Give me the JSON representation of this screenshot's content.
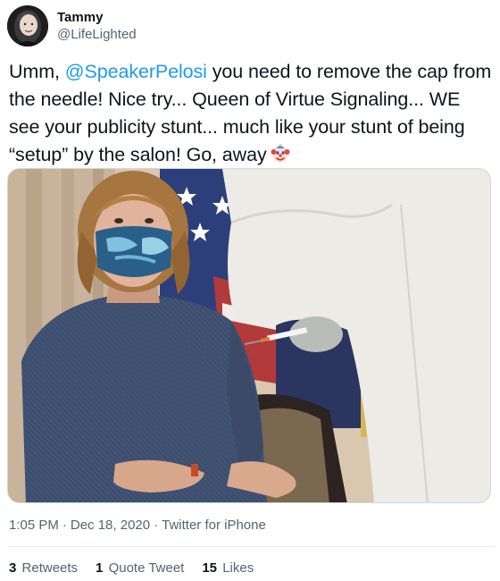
{
  "user": {
    "display_name": "Tammy",
    "handle": "@LifeLighted"
  },
  "tweet": {
    "text_before_mention": "Umm, ",
    "mention": "@SpeakerPelosi",
    "text_after_mention": " you need to remove the cap from the needle!  Nice try... Queen of Virtue Signaling... WE see your publicity stunt... much like your stunt of being “setup” by the salon! Go, away",
    "emoji": "clown-face-icon"
  },
  "meta": {
    "time": "1:05 PM",
    "separator": "·",
    "date": "Dec 18, 2020",
    "client": "Twitter for iPhone"
  },
  "stats": {
    "retweets_count": "3",
    "retweets_label": "Retweets",
    "quotes_count": "1",
    "quotes_label": "Quote Tweet",
    "likes_count": "15",
    "likes_label": "Likes"
  },
  "colors": {
    "link": "#1d9bf0",
    "text": "#0f1419",
    "secondary": "#536471",
    "border": "#cfd9de"
  }
}
